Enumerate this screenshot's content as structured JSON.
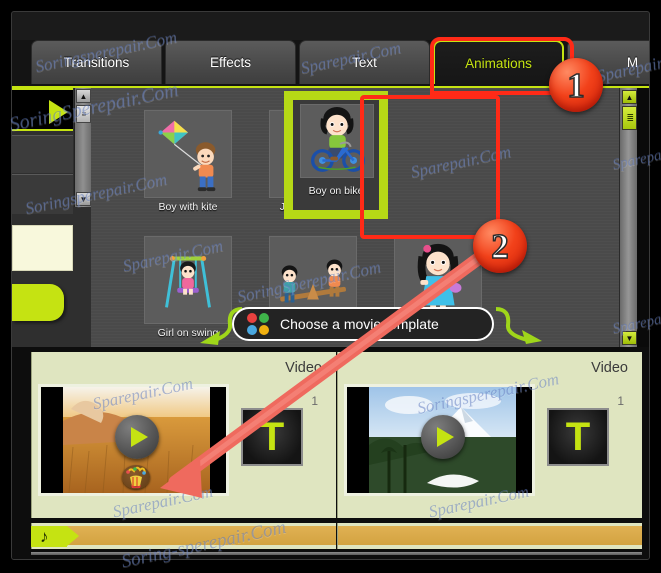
{
  "tabs": [
    {
      "label": "Transitions",
      "active": false
    },
    {
      "label": "Effects",
      "active": false
    },
    {
      "label": "Text",
      "active": false
    },
    {
      "label": "Animations",
      "active": true
    },
    {
      "label": "M",
      "active": false
    }
  ],
  "gallery": {
    "items_row1": [
      {
        "label": "Boy with kite",
        "art": "boy-with-kite"
      },
      {
        "label": "Jump rope girl",
        "art": "jump-rope-girl"
      },
      {
        "label": "Boy on bike",
        "art": "boy-on-bike",
        "selected": true
      }
    ],
    "items_row2": [
      {
        "label": "Girl on swing",
        "art": "girl-on-swing"
      },
      {
        "label": "",
        "art": "seesaw-kids"
      },
      {
        "label": "",
        "art": "girl-with-basket"
      }
    ],
    "left_controls": {
      "play_icon": "play-triangle-icon",
      "scroll_up_icon": "▲",
      "scroll_down_icon": "▼",
      "scroll_grip_icon": "≡"
    },
    "right_scrollbar": {
      "up_icon": "▲",
      "down_icon": "▼",
      "grip_icon": "≣"
    }
  },
  "tooltip": {
    "text": "Choose a movie template",
    "dots": [
      "#e8413f",
      "#3fb44a",
      "#4aa8e0",
      "#f0b010"
    ],
    "icon": "four-color-dots-icon"
  },
  "timeline": {
    "tracks": [
      {
        "header": "Video",
        "index": "1",
        "text_slot": "T",
        "has_audio_badge": true
      },
      {
        "header": "Video",
        "index": "1",
        "text_slot": "T",
        "has_audio_badge": false
      }
    ],
    "audio_tag_icon": "♪",
    "play_icon": "play-triangle-icon"
  },
  "annotations": {
    "badges": [
      {
        "number": "1",
        "target": "animations-tab"
      },
      {
        "number": "2",
        "target": "boy-on-bike-thumbnail"
      }
    ],
    "highlight_color": "#ff2a17",
    "accent_color": "#c5e312"
  },
  "watermarks": [
    "SoringSperepair.Com",
    "Soringsperepair.Com",
    "Sparepair.Com",
    "SoringSperepair.Com",
    "Sparepair.Com",
    "Sparepair.Com",
    "Soringsperepair.Com",
    "Sparepair.Com",
    "Sparepair.Com",
    "Soring-sperepair.Com"
  ]
}
